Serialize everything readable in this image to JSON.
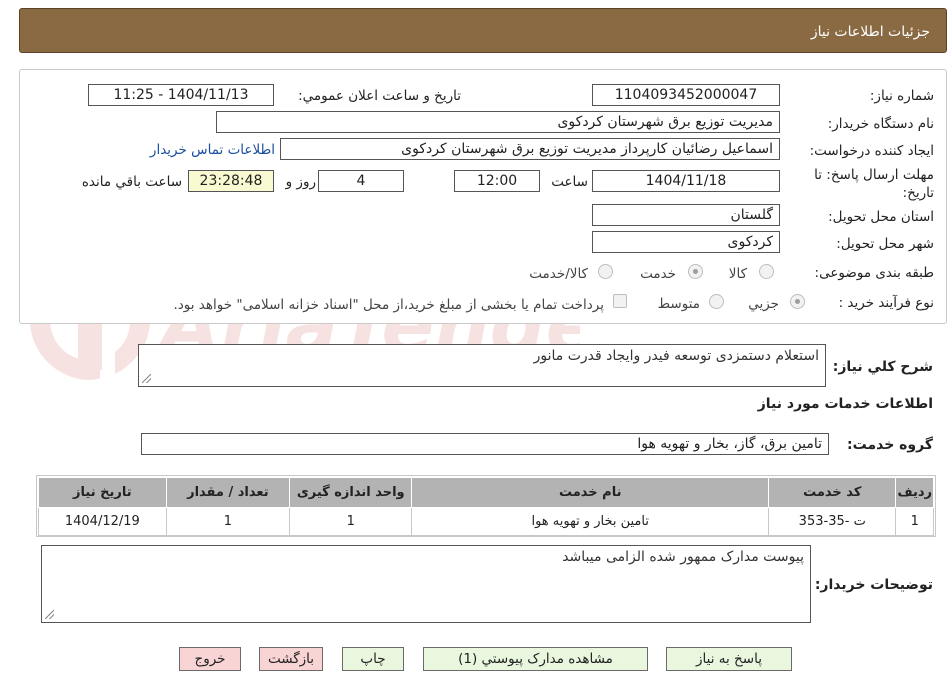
{
  "header": {
    "title": "جزئيات اطلاعات نياز"
  },
  "fields": {
    "need_number_label": "شماره نياز:",
    "need_number": "1104093452000047",
    "announce_label": "تاريخ و ساعت اعلان عمومي:",
    "announce_value": "1404/11/13 - 11:25",
    "buyer_org_label": "نام دستگاه خريدار:",
    "buyer_org": "مديريت توزيع برق شهرستان کردکوی",
    "requester_label": "ايجاد کننده درخواست:",
    "requester": "اسماعيل رضائيان کارپرداز مديريت توزيع برق شهرستان کردکوی",
    "contact_link": "اطلاعات تماس خريدار",
    "deadline_label": "مهلت ارسال پاسخ: تا تاريخ:",
    "deadline_date": "1404/11/18",
    "time_label": "ساعت",
    "deadline_time": "12:00",
    "days_value": "4",
    "days_label": "روز و",
    "remaining_time": "23:28:48",
    "remaining_label": "ساعت باقي مانده",
    "province_label": "استان محل تحويل:",
    "province": "گلستان",
    "city_label": "شهر محل تحويل:",
    "city": "کردکوی",
    "category_label": "طبقه بندی موضوعی:",
    "category_options": [
      "کالا",
      "خدمت",
      "کالا/خدمت"
    ],
    "purchase_label": "نوع فرآيند خريد :",
    "purchase_options": [
      "جزيي",
      "متوسط"
    ],
    "treasury_note": "پرداخت تمام يا بخشی از مبلغ خريد،از محل \"اسناد خزانه اسلامی\" خواهد بود."
  },
  "description": {
    "label": "شرح کلي نياز:",
    "value": "استعلام دستمزدی توسعه فیدر وایجاد قدرت مانور"
  },
  "services": {
    "section_title": "اطلاعات خدمات مورد نياز",
    "group_label": "گروه خدمت:",
    "group_value": "تامين برق، گاز، بخار و تهويه هوا",
    "columns": [
      "رديف",
      "کد خدمت",
      "نام خدمت",
      "واحد اندازه گيری",
      "تعداد / مقدار",
      "تاريخ نياز"
    ],
    "rows": [
      [
        "1",
        "ت -35-353",
        "تامين بخار و تهويه هوا",
        "1",
        "1",
        "1404/12/19"
      ]
    ]
  },
  "buyer_notes": {
    "label": "توضيحات خريدار:",
    "value": "پیوست مدارک ممهور شده الزامی میباشد"
  },
  "buttons": {
    "reply": "پاسخ به نياز",
    "attachments": "مشاهده مدارک پيوستي (1)",
    "print": "چاپ",
    "back": "بازگشت",
    "exit": "خروج"
  },
  "watermark": {
    "text": "AriaTender.neT"
  },
  "colors": {
    "header_bg": "#8a6a42",
    "link": "#1a4fa0",
    "table_header": "#b3b3b3",
    "button_green": "#e9f7df",
    "button_red": "#f8d4d4"
  }
}
